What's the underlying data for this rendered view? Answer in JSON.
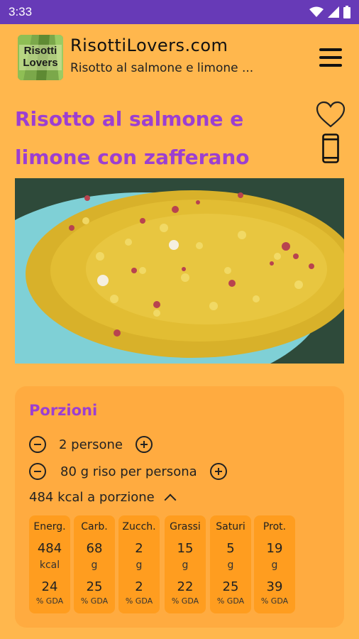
{
  "status_bar": {
    "time": "3:33"
  },
  "app_bar": {
    "logo_text_line1": "Risotti",
    "logo_text_line2": "Lovers",
    "site_title": "RisottiLovers.com",
    "subtitle": "Risotto al salmone e limone ..."
  },
  "recipe": {
    "title": "Risotto al salmone e limone con zafferano"
  },
  "portions": {
    "title": "Porzioni",
    "people": "2 persone",
    "rice": "80 g riso per persona",
    "kcal": "484 kcal a porzione"
  },
  "nutrition": [
    {
      "label": "Energ.",
      "value": "484",
      "unit": "kcal",
      "gda": "24",
      "gda_label": "% GDA"
    },
    {
      "label": "Carb.",
      "value": "68",
      "unit": "g",
      "gda": "25",
      "gda_label": "% GDA"
    },
    {
      "label": "Zucch.",
      "value": "2",
      "unit": "g",
      "gda": "2",
      "gda_label": "% GDA"
    },
    {
      "label": "Grassi",
      "value": "15",
      "unit": "g",
      "gda": "22",
      "gda_label": "% GDA"
    },
    {
      "label": "Saturi",
      "value": "5",
      "unit": "g",
      "gda": "25",
      "gda_label": "% GDA"
    },
    {
      "label": "Prot.",
      "value": "19",
      "unit": "g",
      "gda": "39",
      "gda_label": "% GDA"
    }
  ],
  "colors": {
    "status_bar": "#673ab7",
    "background": "#ffb74d",
    "accent": "#9c3fd1",
    "card": "#ffab40",
    "tile": "#ff9d1f"
  },
  "icons": [
    "wifi-icon",
    "signal-icon",
    "battery-icon",
    "menu-icon",
    "heart-icon",
    "phone-icon",
    "minus-icon",
    "plus-icon",
    "chevron-up-icon"
  ]
}
